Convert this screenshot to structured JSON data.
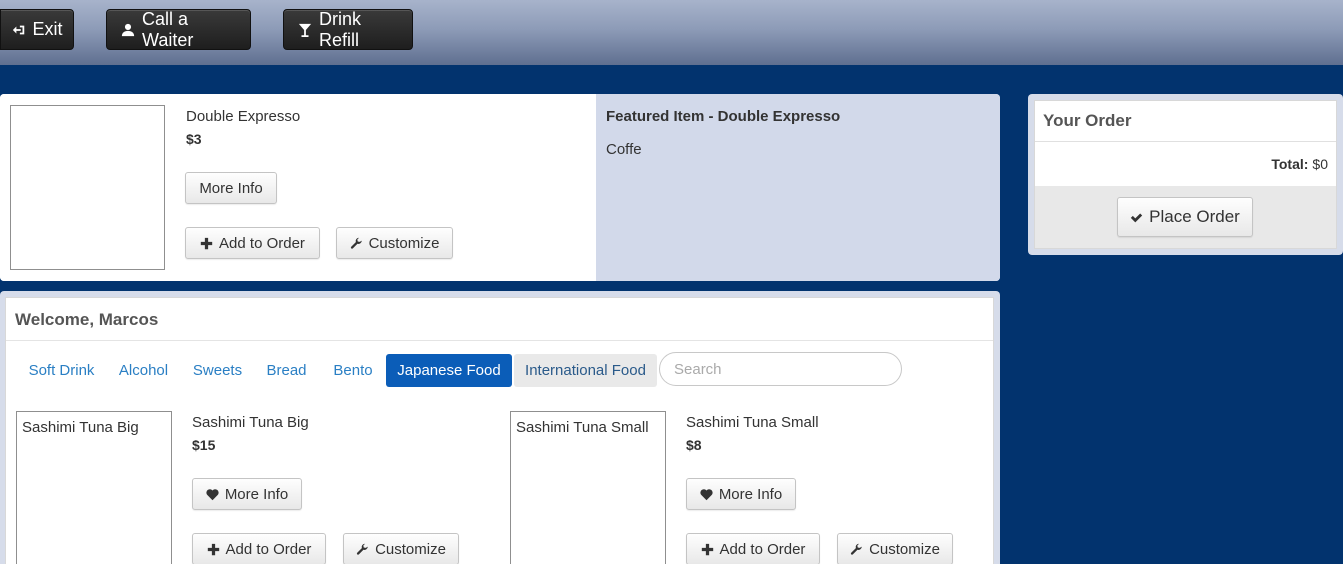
{
  "nav": {
    "exit_label": "Exit",
    "call_waiter_label": "Call a Waiter",
    "drink_refill_label": "Drink Refill"
  },
  "featured": {
    "item_name": "Double Expresso",
    "price": "$3",
    "more_info": "More Info",
    "add_to_order": "Add to Order",
    "customize": "Customize",
    "title": "Featured Item - Double Expresso",
    "description": "Coffe"
  },
  "order": {
    "title": "Your Order",
    "total_label": "Total:",
    "total_value": "$0",
    "place_order": "Place Order"
  },
  "menu": {
    "welcome": "Welcome, Marcos",
    "categories": [
      "Soft Drink",
      "Alcohol",
      "Sweets",
      "Bread",
      "Bento",
      "Japanese Food",
      "International Food"
    ],
    "active_category": "Japanese Food",
    "search_placeholder": "Search",
    "items": [
      {
        "image_label": "Sashimi Tuna Big",
        "name": "Sashimi Tuna Big",
        "price": "$15",
        "more_info": "More Info",
        "add_to_order": "Add to Order",
        "customize": "Customize"
      },
      {
        "image_label": "Sashimi Tuna Small",
        "name": "Sashimi Tuna Small",
        "price": "$8",
        "more_info": "More Info",
        "add_to_order": "Add to Order",
        "customize": "Customize"
      }
    ]
  },
  "colors": {
    "background": "#02336e",
    "active_tab": "#0b5db8",
    "link": "#2a7fc4",
    "featured_panel": "#d2d9ea"
  }
}
